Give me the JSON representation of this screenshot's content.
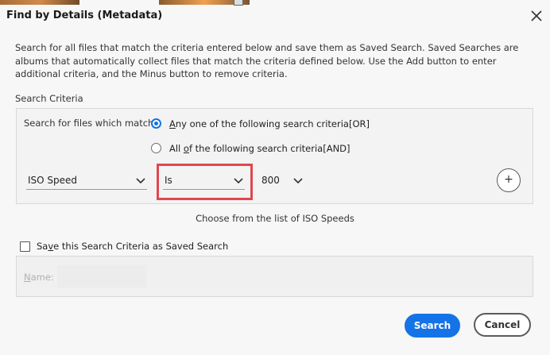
{
  "dialog": {
    "title": "Find by Details (Metadata)",
    "description": "Search for all files that match the criteria entered below and save them as Saved Search. Saved Searches are albums that automatically collect files that match the criteria defined below. Use the Add button to enter additional criteria, and the Minus button to remove criteria."
  },
  "criteria": {
    "section_label": "Search Criteria",
    "match_label": "Search for files which match:",
    "option_any": {
      "accel": "A",
      "rest": "ny one of the following search criteria[OR]",
      "selected": true
    },
    "option_all": {
      "pre": "All ",
      "accel": "o",
      "rest": "f the following search criteria[AND]",
      "selected": false
    },
    "row": {
      "field": "ISO Speed",
      "operator": "Is",
      "value": "800",
      "add_symbol": "+"
    },
    "hint": "Choose from the list of ISO Speeds"
  },
  "save": {
    "label_pre": "Sa",
    "label_accel": "v",
    "label_rest": "e this Search Criteria as Saved Search",
    "checked": false,
    "name_accel": "N",
    "name_rest": "ame:",
    "name_value": ""
  },
  "buttons": {
    "search": "Search",
    "cancel": "Cancel"
  },
  "colors": {
    "accent": "#1473e6",
    "highlight": "#e0474f"
  }
}
